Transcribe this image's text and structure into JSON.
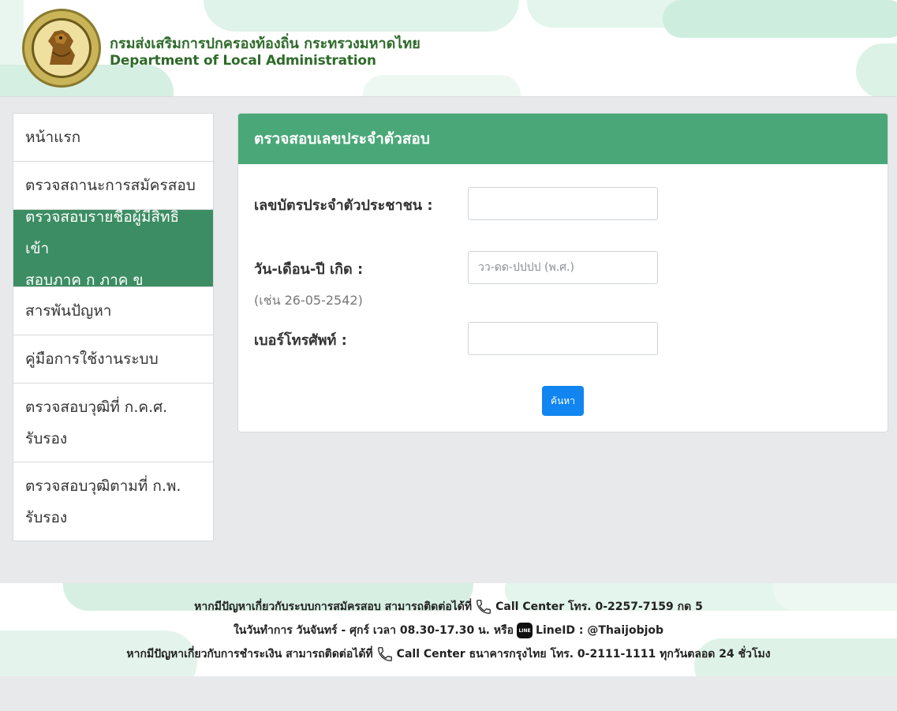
{
  "header": {
    "title_th": "กรมส่งเสริมการปกครองท้องถิ่น กระทรวงมหาดไทย",
    "title_en": "Department of Local Administration",
    "logo_icon": "dla-seal-logo",
    "brand_color": "#2f6b2a"
  },
  "sidebar": {
    "items": [
      {
        "label": "หน้าแรก",
        "active": false
      },
      {
        "label": "ตรวจสถานะการสมัครสอบ",
        "active": false
      },
      {
        "label": "ตรวจสอบรายชื่อผู้มีสิทธิเข้าสอบภาค ก ภาค ข",
        "label_line1": "ตรวจสอบรายชื่อผู้มีสิทธิเข้า",
        "label_line2": "สอบภาค ก ภาค ข",
        "active": true
      },
      {
        "label": "สารพันปัญหา",
        "active": false
      },
      {
        "label": "คู่มือการใช้งานระบบ",
        "active": false
      },
      {
        "label": "ตรวจสอบวุฒิที่ ก.ค.ศ. รับรอง",
        "label_line1": "ตรวจสอบวุฒิที่ ก.ค.ศ.",
        "label_line2": "รับรอง",
        "active": false
      },
      {
        "label": "ตรวจสอบวุฒิตามที่ ก.พ. รับรอง",
        "label_line1": "ตรวจสอบวุฒิตามที่ ก.พ.",
        "label_line2": "รับรอง",
        "active": false
      }
    ],
    "active_color": "#3c8d63"
  },
  "form": {
    "title": "ตรวจสอบเลขประจำตัวสอบ",
    "header_color": "#4aa878",
    "id_card": {
      "label": "เลขบัตรประจำตัวประชาชน :",
      "value": "",
      "placeholder": ""
    },
    "birth_date": {
      "label": "วัน-เดือน-ปี เกิด :",
      "hint": "(เช่น 26-05-2542)",
      "value": "",
      "placeholder": "วว-ดด-ปปปป (พ.ศ.)"
    },
    "phone": {
      "label": "เบอร์โทรศัพท์ :",
      "value": "",
      "placeholder": ""
    },
    "search_label": "ค้นหา",
    "button_color": "#1185f0"
  },
  "footer": {
    "line1_text": "หากมีปัญหาเกี่ยวกับระบบการสมัครสอบ สามารถติดต่อได้ที่",
    "line1_contact": "Call Center โทร. 0-2257-7159 กด 5",
    "line2_text": "ในวันทำการ วันจันทร์ - ศุกร์ เวลา 08.30-17.30 น. หรือ",
    "line2_badge": "LINE",
    "line2_contact": "LineID : @Thaijobjob",
    "line3_text": "หากมีปัญหาเกี่ยวกับการชำระเงิน สามารถติดต่อได้ที่",
    "line3_contact": "Call Center ธนาคารกรุงไทย โทร. 0-2111-1111 ทุกวันตลอด 24 ชั่วโมง",
    "phone_icon": "phone-icon",
    "line_icon": "line-app-icon"
  }
}
